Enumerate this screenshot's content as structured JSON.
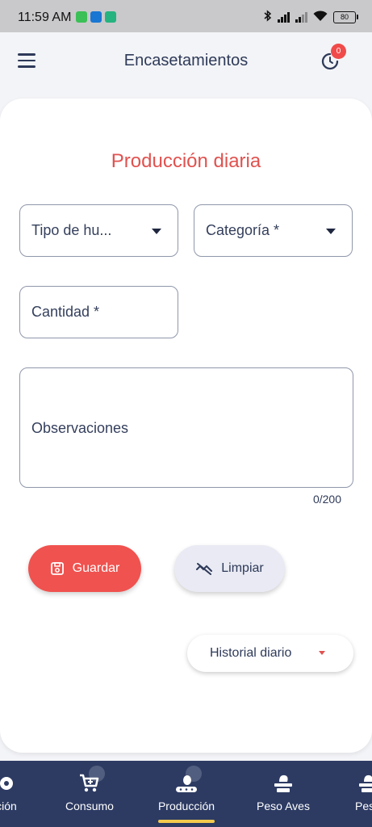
{
  "status_bar": {
    "time": "11:59 AM",
    "battery": "80"
  },
  "app_bar": {
    "title": "Encasetamientos",
    "notification_count": "0"
  },
  "form": {
    "title": "Producción diaria",
    "egg_type": {
      "label": "Tipo de hu..."
    },
    "category": {
      "label": "Categoría *"
    },
    "quantity": {
      "label": "Cantidad *"
    },
    "observations": {
      "label": "Observaciones",
      "counter": "0/200"
    },
    "save_label": "Guardar",
    "clear_label": "Limpiar",
    "history_label": "Historial diario"
  },
  "bottom_nav": {
    "items": [
      {
        "label": "ción",
        "icon": "gear-icon"
      },
      {
        "label": "Consumo",
        "icon": "cart-icon"
      },
      {
        "label": "Producción",
        "icon": "conveyor-icon",
        "active": true
      },
      {
        "label": "Peso Aves",
        "icon": "scale-icon"
      },
      {
        "label": "Peso",
        "icon": "scale-icon"
      }
    ]
  },
  "colors": {
    "accent": "#f0524f",
    "nav_bg": "#2d3b63",
    "active_indicator": "#f2c94c"
  }
}
